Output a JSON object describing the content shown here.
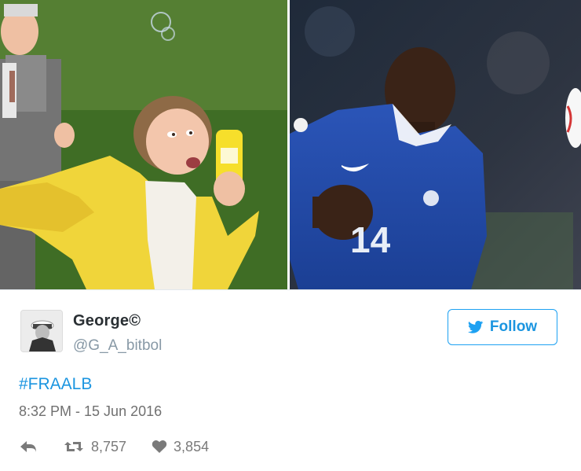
{
  "tweet": {
    "display_name": "George©",
    "handle": "@G_A_bitbol",
    "follow_label": "Follow",
    "hashtag": "#FRAALB",
    "timestamp": "8:32 PM - 15 Jun 2016",
    "retweets": "8,757",
    "likes": "3,854"
  },
  "images": {
    "left": "girl-with-bubbles-photo",
    "right": "football-player-number-14-photo",
    "jersey_number": "14"
  },
  "colors": {
    "accent": "#1da1f2",
    "name": "#292f33",
    "muted": "#8899a6"
  },
  "icons": [
    "twitter-bird-icon",
    "reply-icon",
    "retweet-icon",
    "heart-icon"
  ]
}
